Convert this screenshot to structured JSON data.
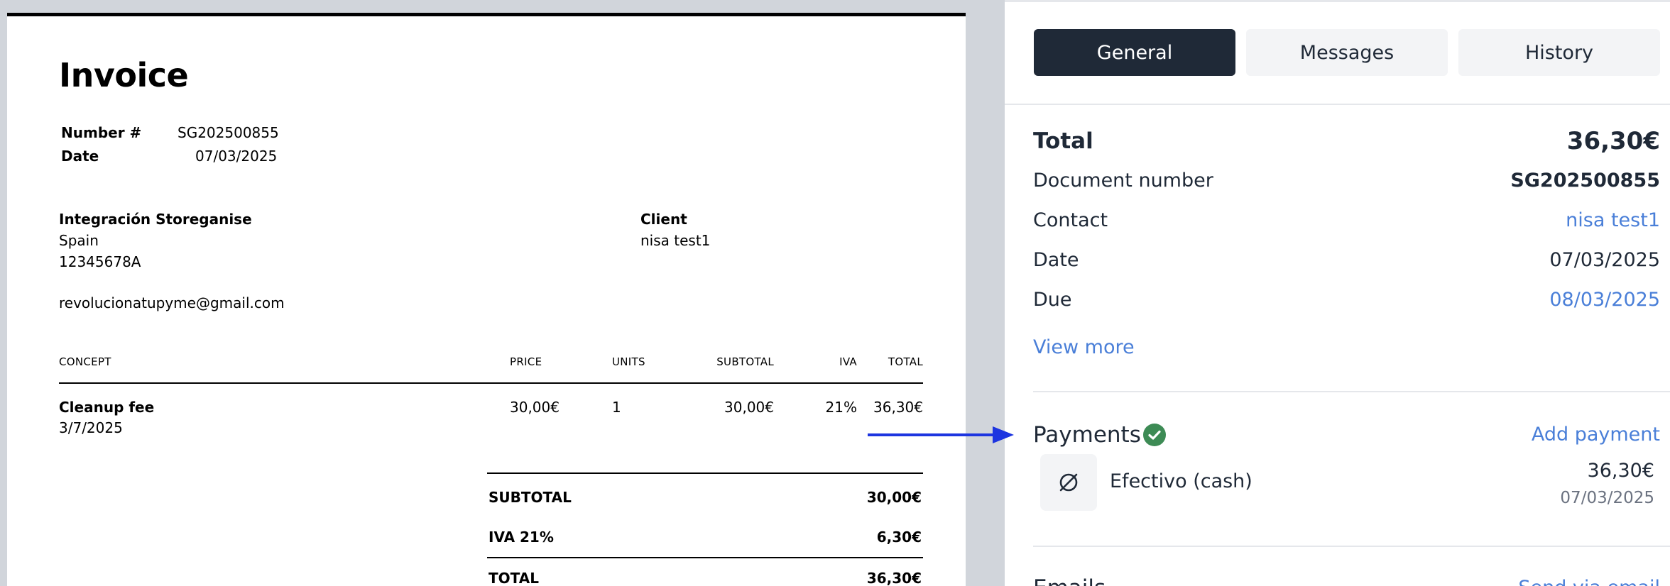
{
  "invoice": {
    "title": "Invoice",
    "number_label": "Number #",
    "number_value": "SG202500855",
    "date_label": "Date",
    "date_value": "07/03/2025",
    "company": {
      "name": "Integración Storeganise",
      "country": "Spain",
      "tax_id": "12345678A",
      "email": "revolucionatupyme@gmail.com"
    },
    "client": {
      "label": "Client",
      "name": "nisa test1"
    },
    "table": {
      "headers": [
        "CONCEPT",
        "PRICE",
        "UNITS",
        "SUBTOTAL",
        "IVA",
        "TOTAL"
      ],
      "rows": [
        {
          "concept": "Cleanup fee",
          "concept_date": "3/7/2025",
          "price": "30,00€",
          "units": "1",
          "subtotal": "30,00€",
          "iva": "21%",
          "total": "36,30€"
        }
      ]
    },
    "totals": {
      "subtotal_label": "SUBTOTAL",
      "subtotal_value": "30,00€",
      "iva_label": "IVA 21%",
      "iva_value": "6,30€",
      "total_label": "TOTAL",
      "total_value": "36,30€"
    }
  },
  "panel": {
    "tabs": [
      {
        "label": "General",
        "active": true
      },
      {
        "label": "Messages",
        "active": false
      },
      {
        "label": "History",
        "active": false
      }
    ],
    "summary": {
      "total_label": "Total",
      "total_value": "36,30€",
      "docnum_label": "Document number",
      "docnum_value": "SG202500855",
      "contact_label": "Contact",
      "contact_value": "nisa test1",
      "date_label": "Date",
      "date_value": "07/03/2025",
      "due_label": "Due",
      "due_value": "08/03/2025",
      "view_more": "View more"
    },
    "payments": {
      "title": "Payments",
      "add_label": "Add payment",
      "items": [
        {
          "method": "Efectivo (cash)",
          "amount": "36,30€",
          "date": "07/03/2025"
        }
      ]
    },
    "emails": {
      "title": "Emails",
      "send_label": "Send via email"
    }
  },
  "colors": {
    "accent_link": "#4a7fd8",
    "active_tab": "#1f2937",
    "check_green": "#3d8b55",
    "arrow_blue": "#1d35e0"
  },
  "icons": [
    "check-circle-icon",
    "no-method-icon",
    "arrow-right-icon"
  ]
}
